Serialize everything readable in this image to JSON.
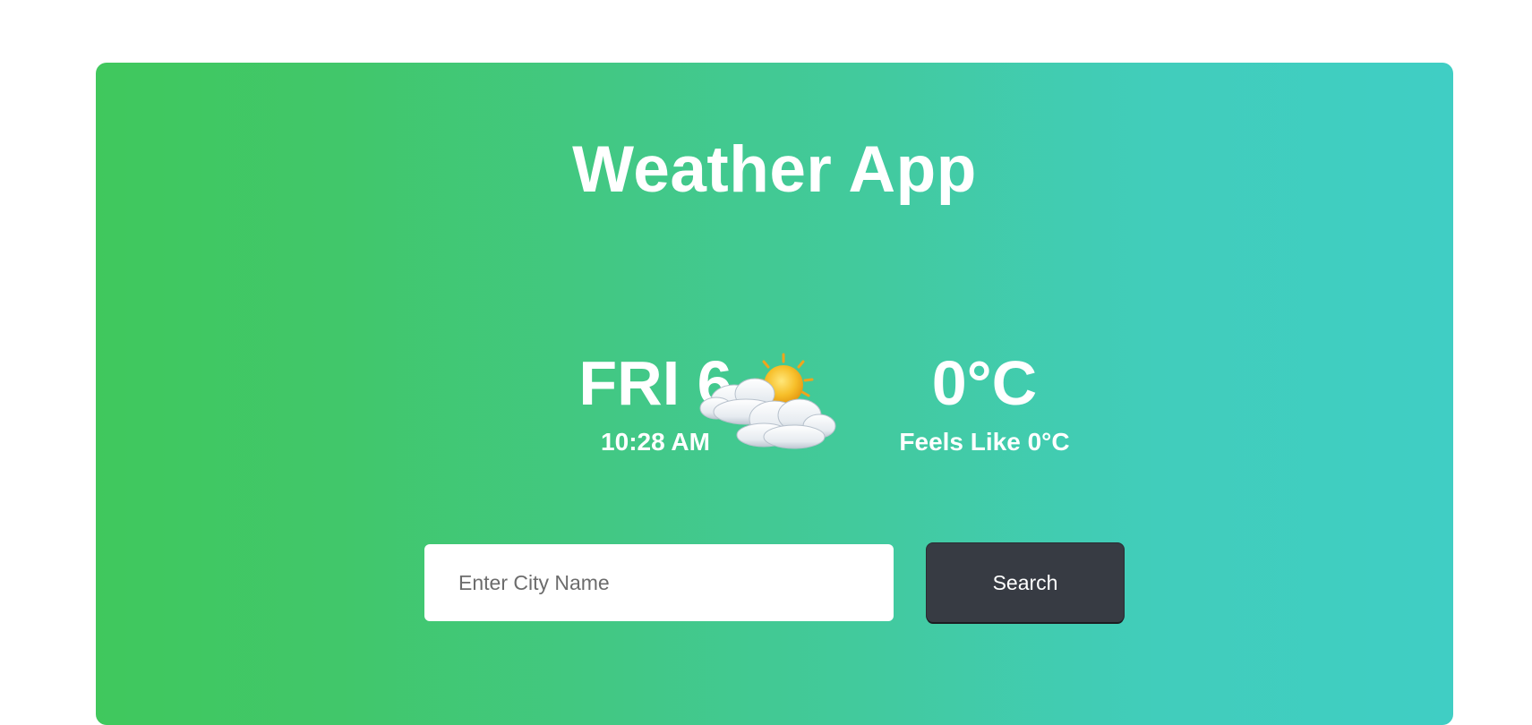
{
  "app": {
    "title": "Weather App"
  },
  "current": {
    "day": "FRI 6",
    "time": "10:28 AM",
    "temperature": "0°C",
    "feels_like": "Feels Like 0°C",
    "icon": "sun-behind-cloud-icon"
  },
  "search": {
    "placeholder": "Enter City Name",
    "value": "",
    "button_label": "Search"
  },
  "colors": {
    "gradient_start": "#40c85d",
    "gradient_end": "#40cec4",
    "button_bg": "#373b43",
    "text": "#ffffff"
  }
}
